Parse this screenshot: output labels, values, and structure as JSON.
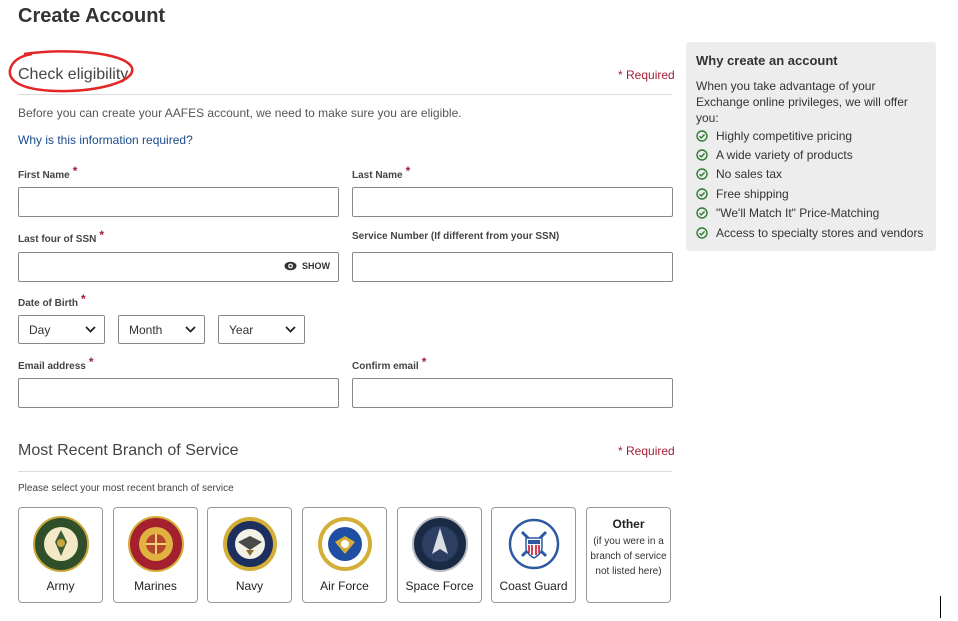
{
  "page": {
    "title": "Create Account"
  },
  "eligibility": {
    "title": "Check eligibility",
    "required": "* Required",
    "intro": "Before you can create your AAFES account, we need to make sure you are eligible.",
    "why_link": "Why is this information required?"
  },
  "form": {
    "first_name": {
      "label": "First Name",
      "value": ""
    },
    "last_name": {
      "label": "Last Name",
      "value": ""
    },
    "ssn": {
      "label": "Last four of SSN",
      "value": "",
      "show_label": "SHOW"
    },
    "service_number": {
      "label": "Service Number (If different from your SSN)",
      "value": ""
    },
    "dob": {
      "label": "Date of Birth",
      "day": "Day",
      "month": "Month",
      "year": "Year"
    },
    "email": {
      "label": "Email address",
      "value": ""
    },
    "confirm_email": {
      "label": "Confirm email",
      "value": ""
    },
    "required_star": "*"
  },
  "branch": {
    "title": "Most Recent Branch of Service",
    "required": "* Required",
    "prompt": "Please select your most recent branch of service",
    "options": [
      {
        "label": "Army",
        "icon": "army-seal-icon",
        "color": "#2f4f2a"
      },
      {
        "label": "Marines",
        "icon": "marines-seal-icon",
        "color": "#a4202e"
      },
      {
        "label": "Navy",
        "icon": "navy-seal-icon",
        "color": "#1c2f5e"
      },
      {
        "label": "Air Force",
        "icon": "air-force-seal-icon",
        "color": "#1f4fa3"
      },
      {
        "label": "Space Force",
        "icon": "space-force-seal-icon",
        "color": "#1b2a44"
      },
      {
        "label": "Coast Guard",
        "icon": "coast-guard-seal-icon",
        "color": "#2c5aa0"
      }
    ],
    "other": {
      "title": "Other",
      "description": "(if you were in a branch of service not listed here)"
    }
  },
  "sidebar": {
    "title": "Why create an account",
    "description": "When you take advantage of your Exchange online privileges, we will offer you:",
    "benefits": [
      "Highly competitive pricing",
      "A wide variety of products",
      "No sales tax",
      "Free shipping",
      "\"We'll Match It\" Price-Matching",
      "Access to specialty stores and vendors"
    ]
  },
  "colors": {
    "required": "#a41f35",
    "link": "#1a4b8c",
    "check": "#2e7d32",
    "annotation_circle": "#e32626",
    "sidebar_bg": "#ededed"
  }
}
